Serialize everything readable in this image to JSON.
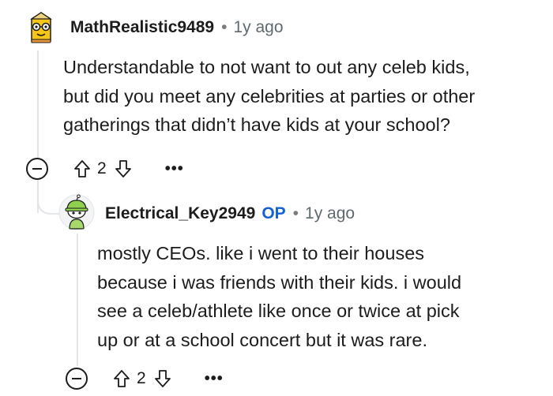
{
  "comments": [
    {
      "username": "MathRealistic9489",
      "separator": "•",
      "time": "1y ago",
      "body": [
        "Understandable to not want to out any celeb kids,",
        "but did you meet any celebrities at parties or other",
        "gatherings that didn’t have kids at your school?"
      ],
      "votes": "2",
      "more": "•••"
    },
    {
      "username": "Electrical_Key2949",
      "badge": "OP",
      "separator": "•",
      "time": "1y ago",
      "body": [
        "mostly CEOs. like i went to their houses",
        "because i was friends with their kids. i would",
        "see a celeb/athlete like once or twice at pick",
        "up or at a school concert but it was rare."
      ],
      "votes": "2",
      "more": "•••"
    }
  ],
  "colors": {
    "op_badge": "#1660d6",
    "thread_line": "#e3e5e8",
    "text": "#1c1c1c",
    "meta": "#5f6a6e"
  },
  "icons": {
    "avatar_1": "pencil-snoo-avatar",
    "avatar_2": "green-hat-snoo-avatar",
    "collapse": "collapse-minus-icon",
    "upvote": "upvote-arrow-icon",
    "downvote": "downvote-arrow-icon",
    "more": "more-options-icon"
  }
}
